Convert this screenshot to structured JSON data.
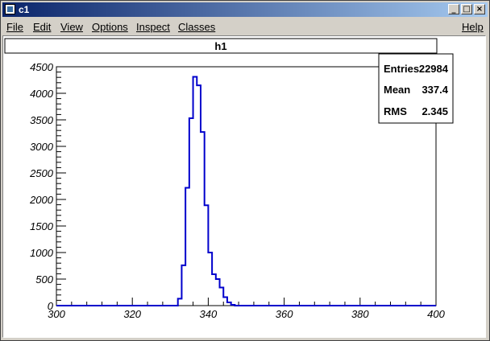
{
  "window": {
    "title": "c1",
    "buttons": [
      "minimize-icon",
      "maximize-icon",
      "close-icon"
    ]
  },
  "menu": {
    "file": "File",
    "edit": "Edit",
    "view": "View",
    "options": "Options",
    "inspect": "Inspect",
    "classes": "Classes",
    "help": "Help"
  },
  "stats": {
    "entries_label": "Entries",
    "entries_value": "22984",
    "mean_label": "Mean",
    "mean_value": "337.4",
    "rms_label": "RMS",
    "rms_value": "2.345"
  },
  "colors": {
    "histogram_line": "#0000cc",
    "titlebar_start": "#0a246a"
  },
  "chart_data": {
    "type": "histogram",
    "title": "h1",
    "xlabel": "",
    "ylabel": "",
    "xlim": [
      300,
      400
    ],
    "ylim": [
      0,
      4500
    ],
    "x_ticks": [
      "300",
      "320",
      "340",
      "360",
      "380",
      "400"
    ],
    "y_ticks": [
      "0",
      "500",
      "1000",
      "1500",
      "2000",
      "2500",
      "3000",
      "3500",
      "4000",
      "4500"
    ],
    "bin_width": 1,
    "bin_edges_start": 300,
    "values": [
      0,
      0,
      0,
      0,
      0,
      0,
      0,
      0,
      0,
      0,
      0,
      0,
      0,
      0,
      0,
      0,
      0,
      0,
      0,
      0,
      0,
      0,
      0,
      0,
      0,
      0,
      0,
      0,
      0,
      0,
      0,
      0,
      130,
      760,
      2220,
      3530,
      4310,
      4150,
      3270,
      1890,
      1000,
      590,
      500,
      340,
      160,
      60,
      15,
      0,
      0,
      0,
      0,
      0,
      0,
      0,
      0,
      0,
      0,
      0,
      0,
      0,
      0,
      0,
      0,
      0,
      0,
      0,
      0,
      0,
      0,
      0,
      0,
      0,
      0,
      0,
      0,
      0,
      0,
      0,
      0,
      0,
      0,
      0,
      0,
      0,
      0,
      0,
      0,
      0,
      0,
      0,
      0,
      0,
      0,
      0,
      0,
      0,
      0,
      0,
      0,
      0
    ],
    "grid": false
  }
}
